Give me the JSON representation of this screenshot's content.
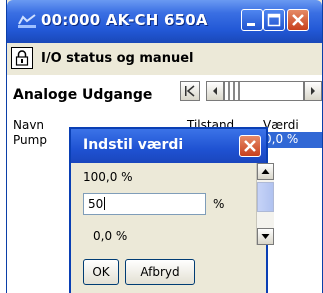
{
  "window": {
    "title": "00:000 AK-CH 650A",
    "toolbar_title": "I/O status og manuel"
  },
  "section": {
    "title": "Analoge Udgange",
    "columns": {
      "name": "Navn",
      "state": "Tilstand",
      "value": "Værdi"
    },
    "row": {
      "name": "Pump",
      "value": "0,0 %"
    }
  },
  "dialog": {
    "title": "Indstil værdi",
    "max_label": "100,0 %",
    "input_value": "50",
    "unit": "%",
    "min_label": "0,0 %",
    "ok_label": "OK",
    "cancel_label": "Afbryd"
  },
  "icons": {
    "app": "gauge-icon",
    "lock": "lock-icon",
    "close": "close-icon"
  },
  "colors": {
    "titlebar": "#2258d6",
    "close_button": "#c8401c",
    "selection": "#3168d5",
    "window_bg": "#ece9d8"
  }
}
